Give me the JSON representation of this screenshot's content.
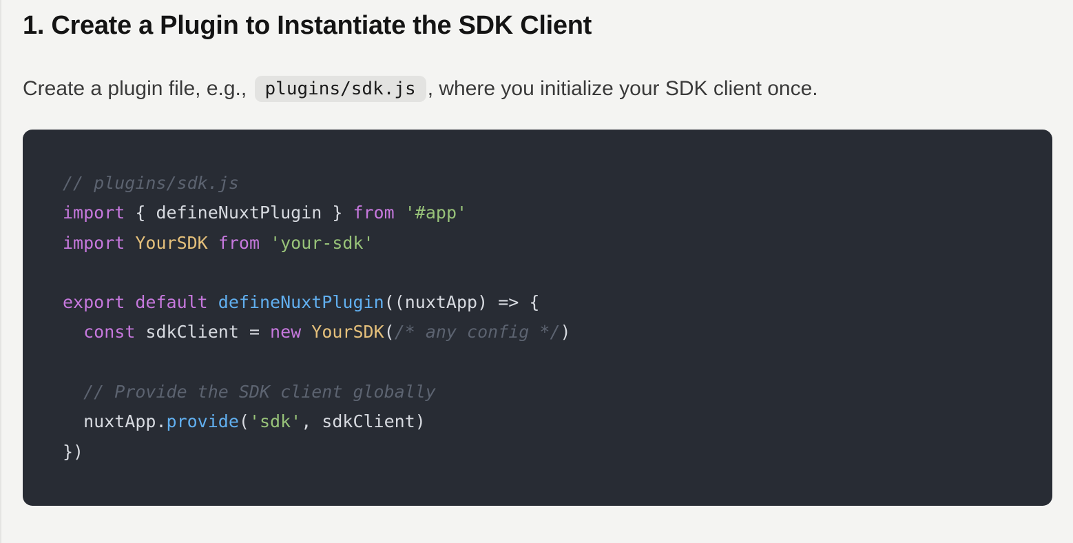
{
  "heading": "1. Create a Plugin to Instantiate the SDK Client",
  "paragraph": {
    "before": "Create a plugin file, e.g., ",
    "code": "plugins/sdk.js",
    "after": ", where you initialize your SDK client once."
  },
  "colors": {
    "page_background": "#f4f4f2",
    "code_background": "#282c34",
    "keyword": "#c678dd",
    "string": "#98c379",
    "class_name": "#e5c07b",
    "function": "#61afef",
    "comment": "#5c6370",
    "plain": "#d7dae0"
  },
  "code_lines": [
    [
      {
        "t": "comment",
        "v": "// plugins/sdk.js"
      }
    ],
    [
      {
        "t": "keyword",
        "v": "import"
      },
      {
        "t": "plain",
        "v": " { defineNuxtPlugin } "
      },
      {
        "t": "keyword",
        "v": "from"
      },
      {
        "t": "plain",
        "v": " "
      },
      {
        "t": "string",
        "v": "'#app'"
      }
    ],
    [
      {
        "t": "keyword",
        "v": "import"
      },
      {
        "t": "plain",
        "v": " "
      },
      {
        "t": "class",
        "v": "YourSDK"
      },
      {
        "t": "plain",
        "v": " "
      },
      {
        "t": "keyword",
        "v": "from"
      },
      {
        "t": "plain",
        "v": " "
      },
      {
        "t": "string",
        "v": "'your-sdk'"
      }
    ],
    [],
    [
      {
        "t": "keyword",
        "v": "export"
      },
      {
        "t": "plain",
        "v": " "
      },
      {
        "t": "keyword",
        "v": "default"
      },
      {
        "t": "plain",
        "v": " "
      },
      {
        "t": "func",
        "v": "defineNuxtPlugin"
      },
      {
        "t": "plain",
        "v": "((nuxtApp) => {"
      }
    ],
    [
      {
        "t": "plain",
        "v": "  "
      },
      {
        "t": "keyword",
        "v": "const"
      },
      {
        "t": "plain",
        "v": " sdkClient = "
      },
      {
        "t": "keyword",
        "v": "new"
      },
      {
        "t": "plain",
        "v": " "
      },
      {
        "t": "class",
        "v": "YourSDK"
      },
      {
        "t": "plain",
        "v": "("
      },
      {
        "t": "comment",
        "v": "/* any config */"
      },
      {
        "t": "plain",
        "v": ")"
      }
    ],
    [],
    [
      {
        "t": "plain",
        "v": "  "
      },
      {
        "t": "comment",
        "v": "// Provide the SDK client globally"
      }
    ],
    [
      {
        "t": "plain",
        "v": "  nuxtApp."
      },
      {
        "t": "func",
        "v": "provide"
      },
      {
        "t": "plain",
        "v": "("
      },
      {
        "t": "string",
        "v": "'sdk'"
      },
      {
        "t": "plain",
        "v": ", sdkClient)"
      }
    ],
    [
      {
        "t": "plain",
        "v": "})"
      }
    ]
  ]
}
